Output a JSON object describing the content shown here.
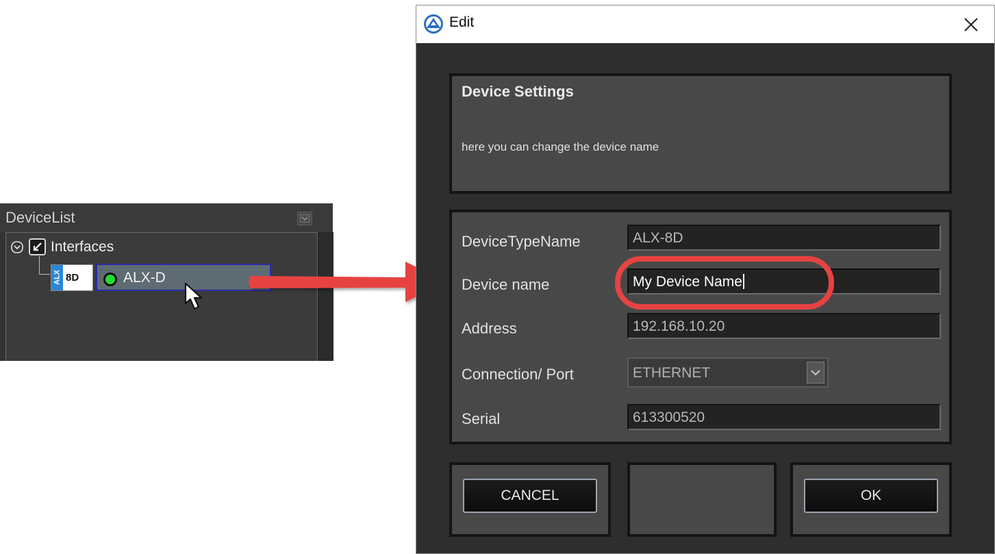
{
  "device_list": {
    "title": "DeviceList",
    "folder_label": "Interfaces",
    "device": {
      "side_label": "ALX",
      "model_label": "8D",
      "name": "ALX-D",
      "status_color": "#22dd33"
    }
  },
  "dialog": {
    "title": "Edit",
    "close_label": "✕",
    "settings": {
      "heading": "Device Settings",
      "description": "here you can change the device name"
    },
    "fields": {
      "device_type_name": {
        "label": "DeviceTypeName",
        "value": "ALX-8D"
      },
      "device_name": {
        "label": "Device name",
        "value": "My Device Name"
      },
      "address": {
        "label": "Address",
        "value": "192.168.10.20"
      },
      "connection": {
        "label": "Connection/ Port",
        "value": "ETHERNET"
      },
      "serial": {
        "label": "Serial",
        "value": "613300520"
      }
    },
    "buttons": {
      "cancel": "CANCEL",
      "ok": "OK"
    }
  },
  "colors": {
    "highlight": "#e74242",
    "accent_blue": "#2d86d6"
  },
  "icons": [
    "collapse-icon",
    "tree-toggle-icon",
    "interface-icon",
    "cursor-icon",
    "arrow-icon",
    "app-logo-icon",
    "close-icon",
    "dropdown-arrow-icon"
  ]
}
